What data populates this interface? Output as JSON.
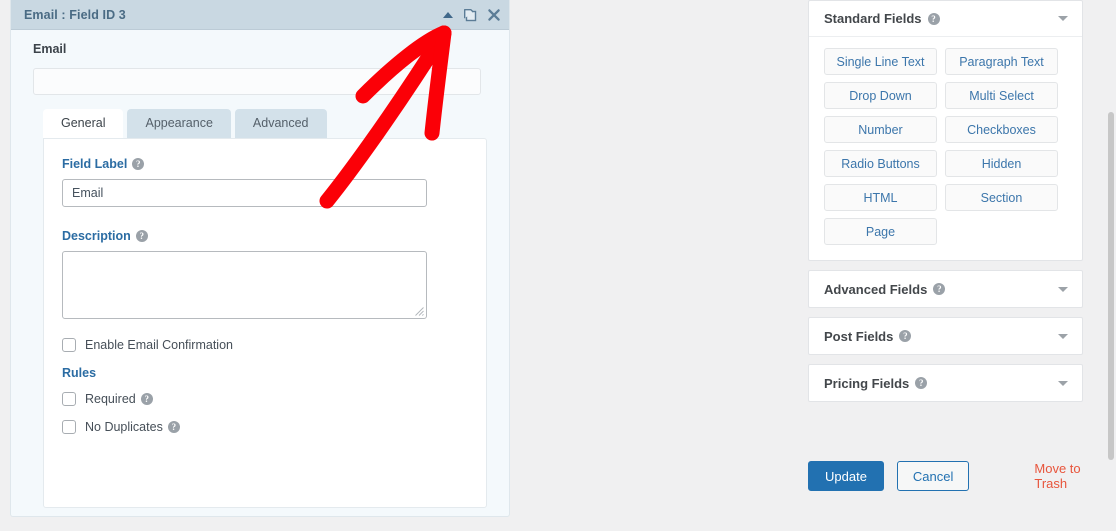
{
  "editor": {
    "header": {
      "title": "Email : Field ID 3",
      "icons": [
        {
          "name": "collapse-icon",
          "glyph": "caret-up"
        },
        {
          "name": "duplicate-icon",
          "glyph": "copy"
        },
        {
          "name": "close-icon",
          "glyph": "x"
        }
      ]
    },
    "preview": {
      "label": "Email",
      "input_value": "",
      "input_placeholder": ""
    },
    "tabs": [
      {
        "label": "General",
        "active": true
      },
      {
        "label": "Appearance",
        "active": false
      },
      {
        "label": "Advanced",
        "active": false
      }
    ],
    "general": {
      "field_label": {
        "label": "Field Label",
        "value": "Email",
        "placeholder": "",
        "helper": "?"
      },
      "description": {
        "label": "Description",
        "value": "",
        "placeholder": "",
        "helper": "?"
      },
      "enable_email_confirmation": {
        "label": "Enable Email Confirmation",
        "checked": false
      },
      "rules_heading": "Rules",
      "rules": [
        {
          "label": "Required",
          "checked": false,
          "helper": "?"
        },
        {
          "label": "No Duplicates",
          "checked": false,
          "helper": "?"
        }
      ]
    }
  },
  "sidebar": {
    "sections": [
      {
        "title": "Standard Fields",
        "helper": "?",
        "expanded": true,
        "buttons": [
          "Single Line Text",
          "Paragraph Text",
          "Drop Down",
          "Multi Select",
          "Number",
          "Checkboxes",
          "Radio Buttons",
          "Hidden",
          "HTML",
          "Section",
          "Page"
        ]
      },
      {
        "title": "Advanced Fields",
        "helper": "?",
        "expanded": false,
        "buttons": []
      },
      {
        "title": "Post Fields",
        "helper": "?",
        "expanded": false,
        "buttons": []
      },
      {
        "title": "Pricing Fields",
        "helper": "?",
        "expanded": false,
        "buttons": []
      }
    ]
  },
  "actions": {
    "update_label": "Update",
    "cancel_label": "Cancel",
    "trash_label": "Move to Trash"
  },
  "colors": {
    "accent_blue": "#2271b1",
    "link_blue": "#3c76ab",
    "label_blue": "#2b6ca3",
    "header_bg": "#c9d8e2",
    "trash_red": "#e8553c",
    "annotation_red": "#fb0007"
  },
  "annotation": {
    "type": "arrow",
    "color": "#fb0007",
    "points_to": "duplicate-icon"
  }
}
